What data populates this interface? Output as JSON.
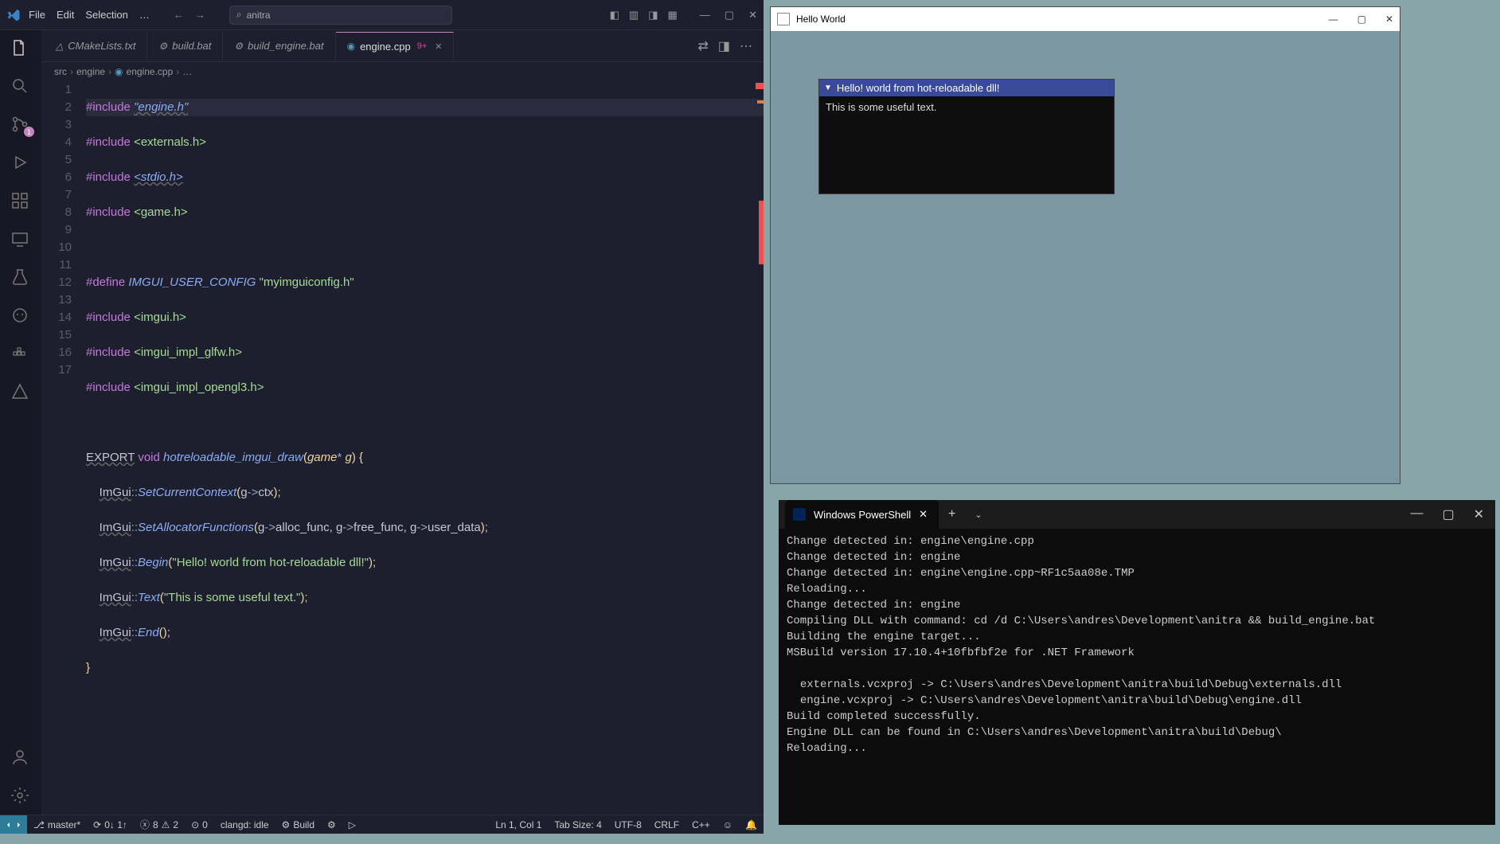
{
  "vscode": {
    "menus": [
      "File",
      "Edit",
      "Selection",
      "…"
    ],
    "search_text": "anitra",
    "tabs": [
      {
        "icon": "cmake",
        "label": "CMakeLists.txt",
        "active": false,
        "dirty": ""
      },
      {
        "icon": "bat",
        "label": "build.bat",
        "active": false,
        "dirty": ""
      },
      {
        "icon": "bat",
        "label": "build_engine.bat",
        "active": false,
        "dirty": ""
      },
      {
        "icon": "cpp",
        "label": "engine.cpp",
        "active": true,
        "dirty": "9+"
      }
    ],
    "breadcrumb": [
      "src",
      "engine",
      "engine.cpp",
      "…"
    ],
    "line_numbers": [
      "1",
      "2",
      "3",
      "4",
      "5",
      "6",
      "7",
      "8",
      "9",
      "10",
      "11",
      "12",
      "13",
      "14",
      "15",
      "16",
      "17"
    ],
    "status": {
      "branch": "master*",
      "sync": "0↓ 1↑",
      "errors": "8",
      "warnings": "2",
      "ports": "0",
      "clangd": "clangd: idle",
      "build": "Build",
      "pos": "Ln 1, Col 1",
      "tabsize": "Tab Size: 4",
      "encoding": "UTF-8",
      "eol": "CRLF",
      "lang": "C++"
    }
  },
  "hello": {
    "window_title": "Hello World",
    "imgui_title": "Hello! world from hot-reloadable dll!",
    "imgui_text": "This is some useful text."
  },
  "powershell": {
    "tab_title": "Windows PowerShell",
    "output": "Change detected in: engine\\engine.cpp\nChange detected in: engine\nChange detected in: engine\\engine.cpp~RF1c5aa08e.TMP\nReloading...\nChange detected in: engine\nCompiling DLL with command: cd /d C:\\Users\\andres\\Development\\anitra && build_engine.bat\nBuilding the engine target...\nMSBuild version 17.10.4+10fbfbf2e for .NET Framework\n\n  externals.vcxproj -> C:\\Users\\andres\\Development\\anitra\\build\\Debug\\externals.dll\n  engine.vcxproj -> C:\\Users\\andres\\Development\\anitra\\build\\Debug\\engine.dll\nBuild completed successfully.\nEngine DLL can be found in C:\\Users\\andres\\Development\\anitra\\build\\Debug\\\nReloading..."
  },
  "code": {
    "l1": {
      "pp": "#include",
      "s": "\"engine.h\""
    },
    "l2": {
      "pp": "#include",
      "s": "<externals.h>"
    },
    "l3": {
      "pp": "#include",
      "s": "<stdio.h>"
    },
    "l4": {
      "pp": "#include",
      "s": "<game.h>"
    },
    "l6": {
      "pp": "#define",
      "id": "IMGUI_USER_CONFIG",
      "s": "\"myimguiconfig.h\""
    },
    "l7": {
      "pp": "#include",
      "s": "<imgui.h>"
    },
    "l8": {
      "pp": "#include",
      "s": "<imgui_impl_glfw.h>"
    },
    "l9": {
      "pp": "#include",
      "s": "<imgui_impl_opengl3.h>"
    },
    "l11": {
      "kw1": "EXPORT",
      "kw2": "void",
      "fn": "hotreloadable_imgui_draw",
      "ty": "game",
      "pa": "g"
    },
    "l12": {
      "ns": "ImGui",
      "fn": "SetCurrentContext",
      "pa": "g",
      "mem": "ctx"
    },
    "l13": {
      "ns": "ImGui",
      "fn": "SetAllocatorFunctions",
      "pa": "g",
      "m1": "alloc_func",
      "m2": "free_func",
      "m3": "user_data"
    },
    "l14": {
      "ns": "ImGui",
      "fn": "Begin",
      "s": "\"Hello! world from hot-reloadable dll!\""
    },
    "l15": {
      "ns": "ImGui",
      "fn": "Text",
      "s": "\"This is some useful text.\""
    },
    "l16": {
      "ns": "ImGui",
      "fn": "End"
    }
  }
}
